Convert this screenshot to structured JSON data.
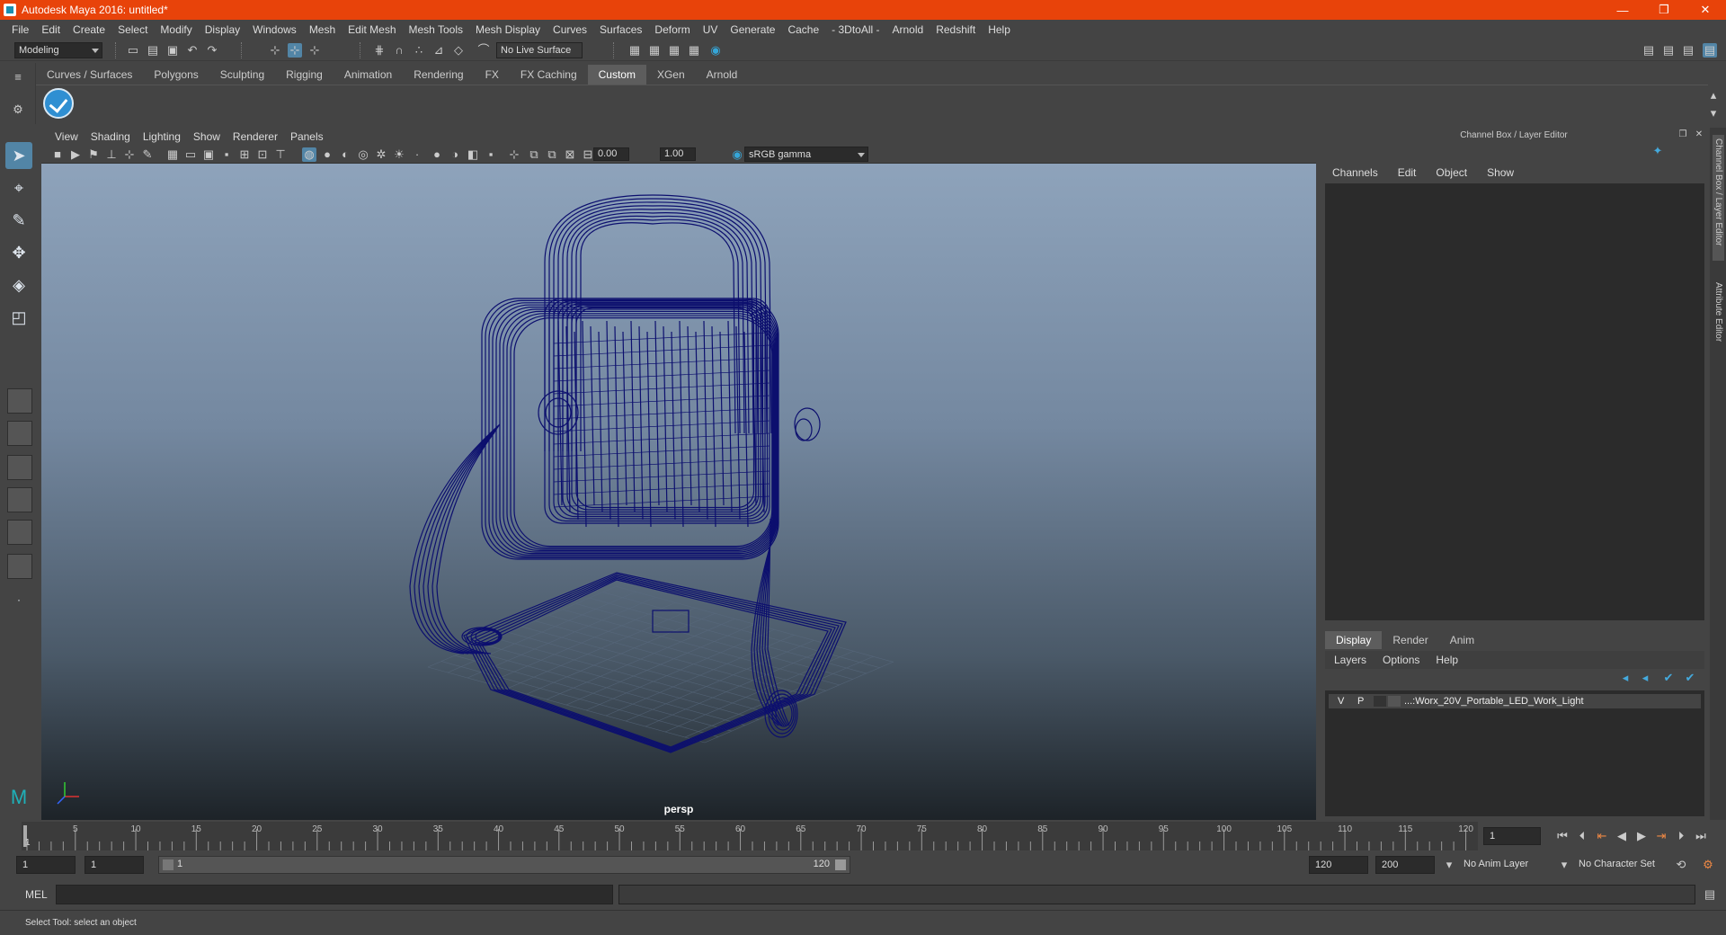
{
  "window": {
    "title": "Autodesk Maya 2016: untitled*",
    "minimize": "—",
    "restore": "❐",
    "close": "✕"
  },
  "menubar": [
    "File",
    "Edit",
    "Create",
    "Select",
    "Modify",
    "Display",
    "Windows",
    "Mesh",
    "Edit Mesh",
    "Mesh Tools",
    "Mesh Display",
    "Curves",
    "Surfaces",
    "Deform",
    "UV",
    "Generate",
    "Cache",
    "- 3DtoAll -",
    "Arnold",
    "Redshift",
    "Help"
  ],
  "statusline": {
    "mode": "Modeling",
    "live_surface": "No Live Surface"
  },
  "shelf": {
    "tabs": [
      "Curves / Surfaces",
      "Polygons",
      "Sculpting",
      "Rigging",
      "Animation",
      "Rendering",
      "FX",
      "FX Caching",
      "Custom",
      "XGen",
      "Arnold"
    ],
    "active_tab": "Custom"
  },
  "viewport": {
    "menu": [
      "View",
      "Shading",
      "Lighting",
      "Show",
      "Renderer",
      "Panels"
    ],
    "exposure": "0.00",
    "gamma": "1.00",
    "color_space": "sRGB gamma",
    "camera": "persp",
    "wire_color": "#0c0f6e"
  },
  "channel_box": {
    "title": "Channel Box / Layer Editor",
    "menu": [
      "Channels",
      "Edit",
      "Object",
      "Show"
    ],
    "layer_tabs": [
      "Display",
      "Render",
      "Anim"
    ],
    "active_layer_tab": "Display",
    "layer_menu": [
      "Layers",
      "Options",
      "Help"
    ],
    "layer": {
      "v": "V",
      "p": "P",
      "name": "...:Worx_20V_Portable_LED_Work_Light"
    }
  },
  "sidebar": {
    "tab1": "Channel Box / Layer Editor",
    "tab2": "Attribute Editor"
  },
  "timeline": {
    "ticks": [
      5,
      10,
      15,
      20,
      25,
      30,
      35,
      40,
      45,
      50,
      55,
      60,
      65,
      70,
      75,
      80,
      85,
      90,
      95,
      100,
      105,
      110,
      115,
      120
    ],
    "start_label": "1",
    "current_frame": "1"
  },
  "range": {
    "start": "1",
    "playback_start": "1",
    "slider_start": "1",
    "slider_end": "120",
    "playback_end": "120",
    "end": "200",
    "anim_layer": "No Anim Layer",
    "character_set": "No Character Set"
  },
  "cmdline": {
    "label": "MEL"
  },
  "helpline": {
    "text": "Select Tool: select an object"
  }
}
